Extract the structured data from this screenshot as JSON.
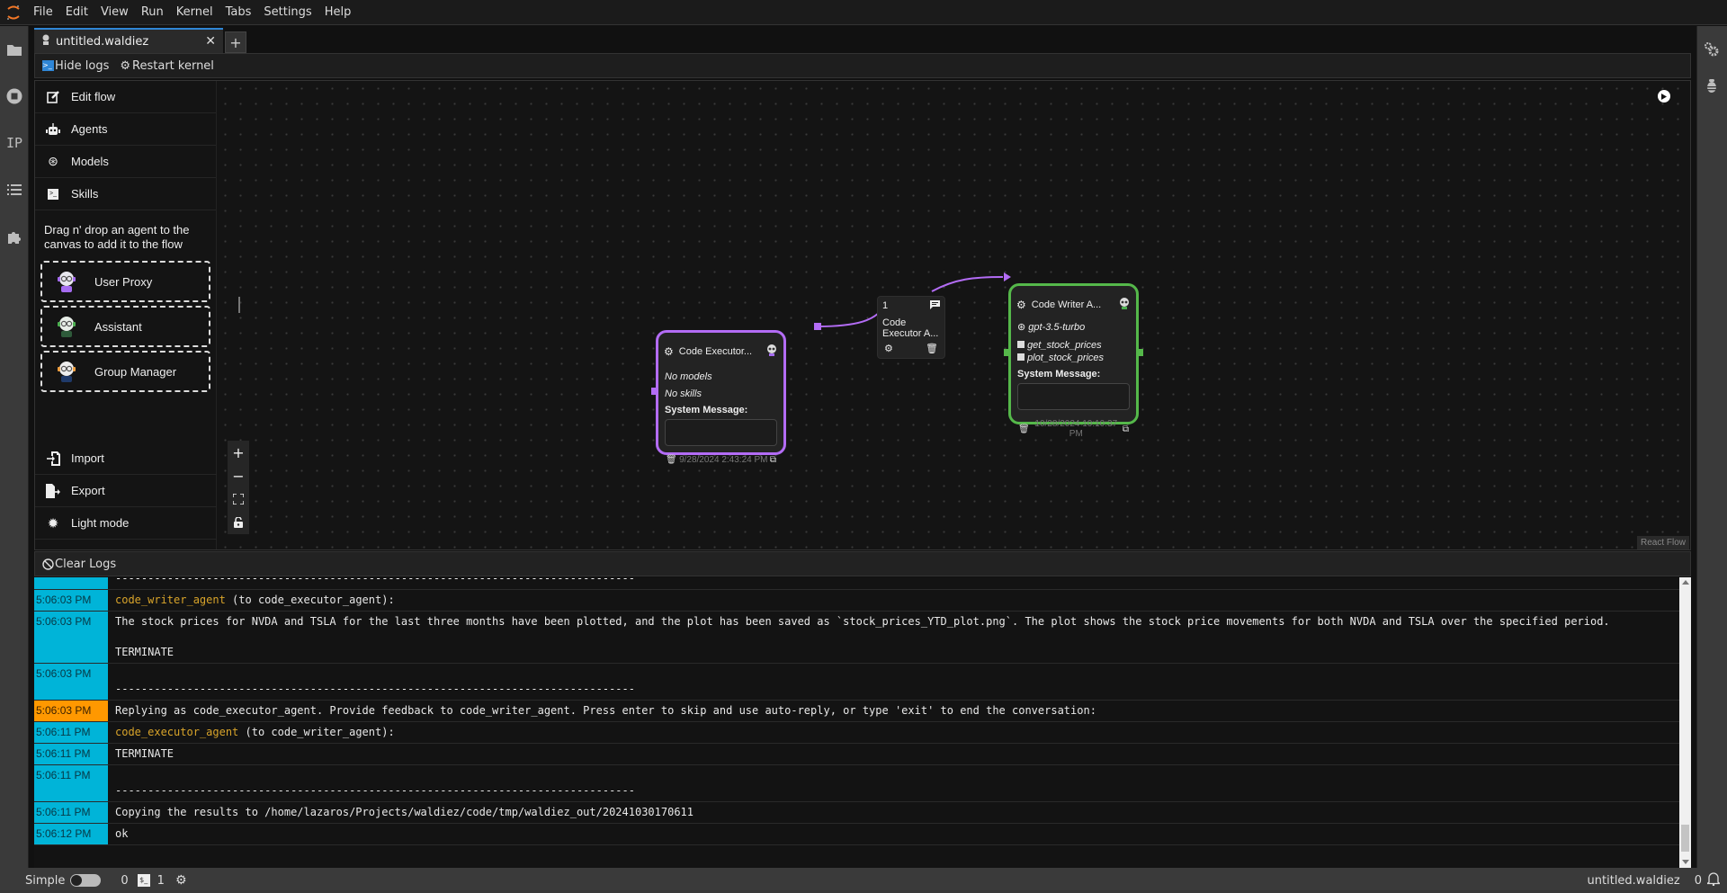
{
  "menubar": {
    "items": [
      "File",
      "Edit",
      "View",
      "Run",
      "Kernel",
      "Tabs",
      "Settings",
      "Help"
    ]
  },
  "left_rail": {
    "icons": [
      "folder-icon",
      "stop-circle-icon",
      "ip-icon",
      "list-icon",
      "puzzle-icon"
    ],
    "ip_label": "IP"
  },
  "tabs": [
    {
      "label": "untitled.waldiez",
      "active": true
    }
  ],
  "tab_add_label": "+",
  "toolbar": {
    "hide_logs": "Hide logs",
    "restart_kernel": "Restart kernel"
  },
  "sidebar": {
    "items": [
      {
        "label": "Edit flow",
        "icon": "edit-icon"
      },
      {
        "label": "Agents",
        "icon": "robot-icon"
      },
      {
        "label": "Models",
        "icon": "openai-icon"
      },
      {
        "label": "Skills",
        "icon": "terminal-icon"
      }
    ],
    "hint": "Drag n' drop an agent to the canvas to add it to the flow",
    "agents": [
      {
        "label": "User Proxy",
        "color": "#a56cf0"
      },
      {
        "label": "Assistant",
        "color": "#4caf50"
      },
      {
        "label": "Group Manager",
        "color": "#f0a040"
      }
    ],
    "bottom_items": [
      {
        "label": "Import",
        "icon": "import-icon"
      },
      {
        "label": "Export",
        "icon": "export-icon"
      },
      {
        "label": "Light mode",
        "icon": "sun-icon"
      }
    ]
  },
  "flow_controls": {
    "zoom_in": "+",
    "zoom_out": "−"
  },
  "nodes": {
    "executor": {
      "title": "Code Executor...",
      "models": "No models",
      "skills": "No skills",
      "system_message_label": "System Message:",
      "system_message_value": "",
      "date": "9/28/2024 2:43:24 PM",
      "border_color": "#b36cf5"
    },
    "writer": {
      "title": "Code Writer A...",
      "model": "gpt-3.5-turbo",
      "skills": [
        "get_stock_prices",
        "plot_stock_prices"
      ],
      "system_message_label": "System Message:",
      "system_message_value": "",
      "date": "10/28/2024 10:10:37 PM",
      "border_color": "#55b84a"
    },
    "edge": {
      "order": "1",
      "label_line1": "Code",
      "label_line2": "Executor A..."
    }
  },
  "react_flow_label": "React Flow",
  "logs": {
    "clear_label": "Clear Logs",
    "entries": [
      {
        "ts": "",
        "parts": [
          {
            "text": "--------------------------------------------------------------------------------"
          }
        ]
      },
      {
        "ts": "5:06:03 PM",
        "parts": [
          {
            "text": "code_writer_agent",
            "agent": true
          },
          {
            "text": " (to code_executor_agent):\n"
          }
        ]
      },
      {
        "ts": "5:06:03 PM",
        "parts": [
          {
            "text": "The stock prices for NVDA and TSLA for the last three months have been plotted, and the plot has been saved as `stock_prices_YTD_plot.png`. The plot shows the stock price movements for both NVDA and TSLA over the specified period.\n\nTERMINATE"
          }
        ]
      },
      {
        "ts": "5:06:03 PM",
        "parts": [
          {
            "text": "\n--------------------------------------------------------------------------------"
          }
        ]
      },
      {
        "ts": "5:06:03 PM",
        "warn": true,
        "parts": [
          {
            "text": "Replying as code_executor_agent. Provide feedback to code_writer_agent. Press enter to skip and use auto-reply, or type 'exit' to end the conversation:"
          }
        ]
      },
      {
        "ts": "5:06:11 PM",
        "parts": [
          {
            "text": "code_executor_agent",
            "agent": true
          },
          {
            "text": " (to code_writer_agent):\n"
          }
        ]
      },
      {
        "ts": "5:06:11 PM",
        "parts": [
          {
            "text": "TERMINATE"
          }
        ]
      },
      {
        "ts": "5:06:11 PM",
        "parts": [
          {
            "text": "\n--------------------------------------------------------------------------------"
          }
        ]
      },
      {
        "ts": "5:06:11 PM",
        "parts": [
          {
            "text": "Copying the results to /home/lazaros/Projects/waldiez/code/tmp/waldiez_out/20241030170611"
          }
        ]
      },
      {
        "ts": "5:06:12 PM",
        "parts": [
          {
            "text": "ok"
          }
        ]
      }
    ]
  },
  "statusbar": {
    "mode_label": "Simple",
    "mode_on": false,
    "terminals_count": "0",
    "kernels_count": "1",
    "document_name": "untitled.waldiez",
    "notifications_count": "0"
  }
}
